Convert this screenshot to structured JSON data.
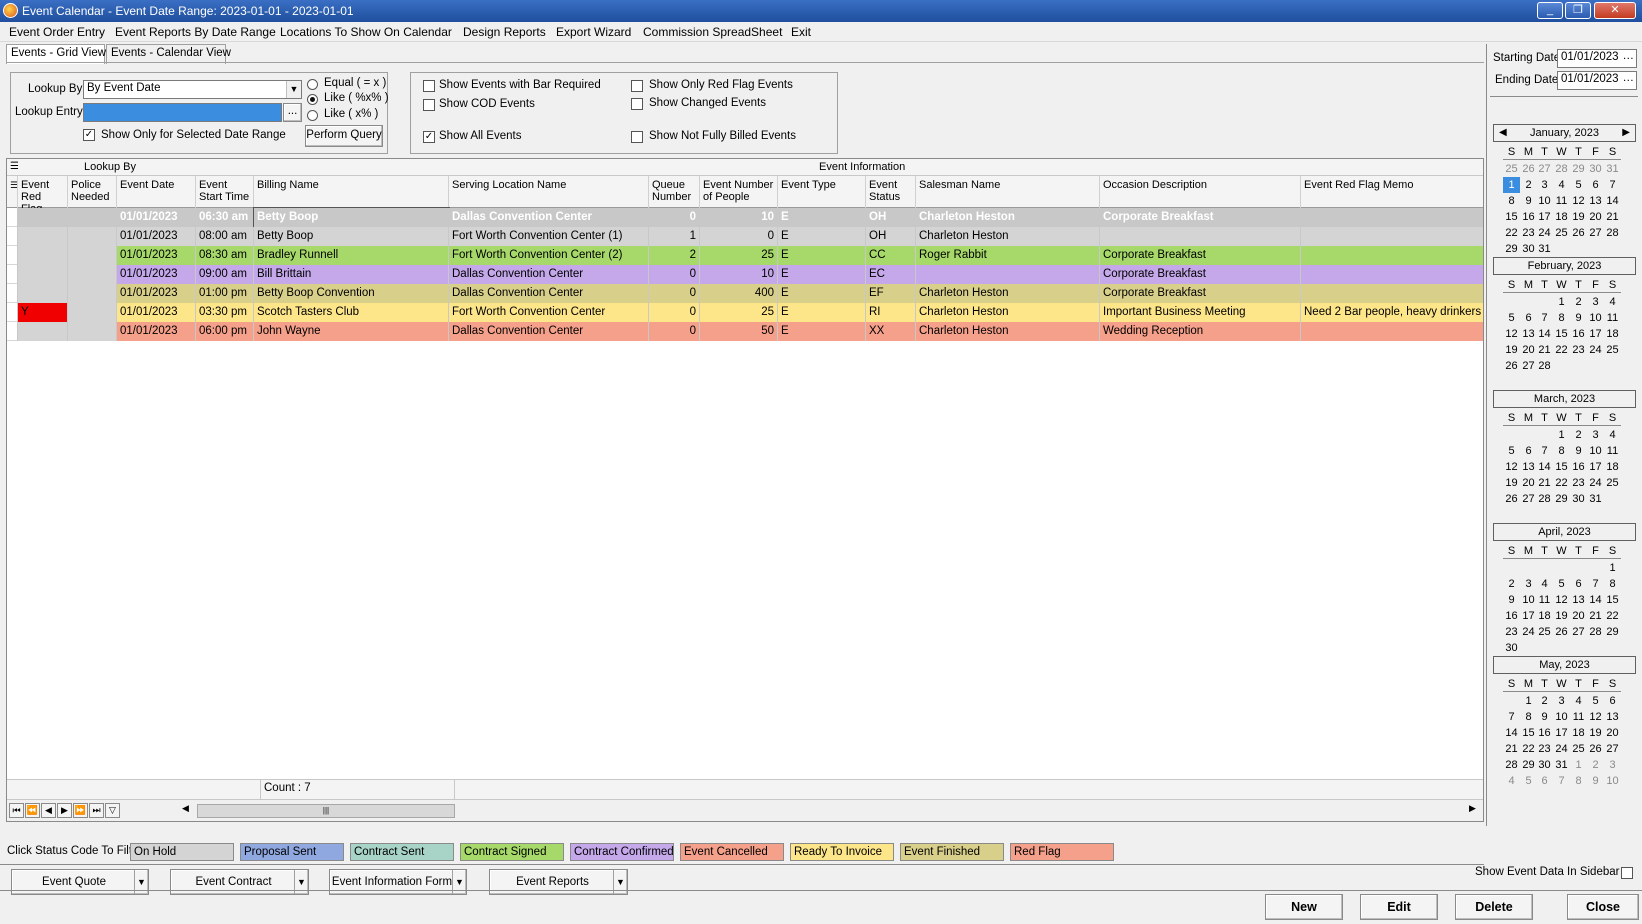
{
  "window": {
    "title": "Event Calendar - Event Date Range: 2023-01-01 - 2023-01-01",
    "minimize": "_",
    "restore": "❐",
    "close": "✕"
  },
  "menu": [
    "Event Order Entry",
    "Event Reports By Date Range",
    "Locations To Show On Calendar",
    "Design Reports",
    "Export Wizard",
    "Commission SpreadSheet",
    "Exit"
  ],
  "tabs": [
    "Events - Grid View",
    "Events - Calendar View"
  ],
  "lookup": {
    "lookup_by_label": "Lookup By",
    "lookup_by_value": "By Event Date",
    "lookup_entry_label": "Lookup Entry",
    "lookup_entry_value": "",
    "ellipsis": "...",
    "radio_equal": "Equal ( = x )",
    "radio_like_both": "Like ( %x% )",
    "radio_like_start": "Like ( x% )",
    "selected_radio": "Like ( %x% )",
    "show_selected_range": "Show Only for Selected Date Range",
    "show_selected_range_checked": true,
    "perform_query": "Perform Query"
  },
  "filters": {
    "bar_required": "Show Events with Bar Required",
    "cod": "Show COD Events",
    "all": "Show All Events",
    "all_checked": true,
    "red_flag": "Show Only Red Flag Events",
    "changed": "Show Changed Events",
    "not_billed": "Show Not Fully Billed Events"
  },
  "grid": {
    "band_lookup": "Lookup By",
    "band_info": "Event Information",
    "columns": {
      "red_flag": "Event Red Flag",
      "police": "Police Needed",
      "date": "Event Date",
      "start": "Event Start Time",
      "billing": "Billing Name",
      "location": "Serving Location Name",
      "queue": "Queue Number",
      "people": "Event Number of People",
      "type": "Event Type",
      "status": "Event Status",
      "salesman": "Salesman Name",
      "occasion": "Occasion Description",
      "memo": "Event Red Flag Memo"
    },
    "rows": [
      {
        "red_flag": "",
        "police": "",
        "date": "01/01/2023",
        "start": "06:30 am",
        "billing": "Betty Boop",
        "location": "Dallas Convention Center",
        "queue": "0",
        "people": "10",
        "type": "E",
        "status": "OH",
        "salesman": "Charleton Heston",
        "occasion": "Corporate Breakfast",
        "memo": "",
        "color": "#c8c8c8",
        "selected": true
      },
      {
        "red_flag": "",
        "police": "",
        "date": "01/01/2023",
        "start": "08:00 am",
        "billing": "Betty Boop",
        "location": "Fort Worth Convention Center (1)",
        "queue": "1",
        "people": "0",
        "type": "E",
        "status": "OH",
        "salesman": "Charleton Heston",
        "occasion": "",
        "memo": "",
        "color": "#d4d4d4",
        "selected": false
      },
      {
        "red_flag": "",
        "police": "",
        "date": "01/01/2023",
        "start": "08:30 am",
        "billing": "Bradley Runnell",
        "location": "Fort Worth Convention Center (2)",
        "queue": "2",
        "people": "25",
        "type": "E",
        "status": "CC",
        "salesman": "Roger Rabbit",
        "occasion": "Corporate Breakfast",
        "memo": "",
        "color": "#a6d96a",
        "selected": false
      },
      {
        "red_flag": "",
        "police": "",
        "date": "01/01/2023",
        "start": "09:00 am",
        "billing": "Bill Brittain",
        "location": "Dallas Convention Center",
        "queue": "0",
        "people": "10",
        "type": "E",
        "status": "EC",
        "salesman": "",
        "occasion": "Corporate Breakfast",
        "memo": "",
        "color": "#c4a8ea",
        "selected": false
      },
      {
        "red_flag": "",
        "police": "",
        "date": "01/01/2023",
        "start": "01:00 pm",
        "billing": "Betty Boop Convention",
        "location": "Dallas Convention Center",
        "queue": "0",
        "people": "400",
        "type": "E",
        "status": "EF",
        "salesman": "Charleton Heston",
        "occasion": "Corporate Breakfast",
        "memo": "",
        "color": "#d8cf8a",
        "selected": false
      },
      {
        "red_flag": "Y",
        "police": "",
        "date": "01/01/2023",
        "start": "03:30 pm",
        "billing": "Scotch Tasters Club",
        "location": "Fort Worth Convention Center",
        "queue": "0",
        "people": "25",
        "type": "E",
        "status": "RI",
        "salesman": "Charleton Heston",
        "occasion": "Important Business Meeting",
        "memo": "Need 2 Bar people, heavy drinkers",
        "color": "#fde68a",
        "selected": false
      },
      {
        "red_flag": "",
        "police": "",
        "date": "01/01/2023",
        "start": "06:00 pm",
        "billing": "John Wayne",
        "location": "Dallas Convention Center",
        "queue": "0",
        "people": "50",
        "type": "E",
        "status": "XX",
        "salesman": "Charleton Heston",
        "occasion": "Wedding Reception",
        "memo": "",
        "color": "#f5a08a",
        "selected": false
      }
    ],
    "count": "Count : 7"
  },
  "status_filter": {
    "label": "Click Status Code To Filter",
    "items": [
      {
        "label": "On Hold",
        "color": "#d4d4d4"
      },
      {
        "label": "Proposal Sent",
        "color": "#8fa8e0"
      },
      {
        "label": "Contract Sent",
        "color": "#a8d4c8"
      },
      {
        "label": "Contract Signed",
        "color": "#a6d96a"
      },
      {
        "label": "Contract Confirmed",
        "color": "#c4a8ea"
      },
      {
        "label": "Event Cancelled",
        "color": "#f5a08a"
      },
      {
        "label": "Ready To Invoice",
        "color": "#fde68a"
      },
      {
        "label": "Event Finished",
        "color": "#d8cf8a"
      },
      {
        "label": "Red Flag",
        "color": "#f5a08a"
      }
    ]
  },
  "actions": {
    "quote": "Event Quote",
    "contract": "Event Contract",
    "info_form": "Event Information Form",
    "reports": "Event Reports",
    "sidebar_label": "Show Event Data In Sidebar",
    "new": "New",
    "edit": "Edit",
    "delete": "Delete",
    "close": "Close"
  },
  "sidebar": {
    "starting_label": "Starting Date",
    "starting_value": "01/01/2023",
    "ending_label": "Ending Date",
    "ending_value": "01/01/2023",
    "dow": [
      "S",
      "M",
      "T",
      "W",
      "T",
      "F",
      "S"
    ],
    "months": [
      {
        "title": "January, 2023",
        "weeks": [
          [
            "25",
            "26",
            "27",
            "28",
            "29",
            "30",
            "31"
          ],
          [
            "1",
            "2",
            "3",
            "4",
            "5",
            "6",
            "7"
          ],
          [
            "8",
            "9",
            "10",
            "11",
            "12",
            "13",
            "14"
          ],
          [
            "15",
            "16",
            "17",
            "18",
            "19",
            "20",
            "21"
          ],
          [
            "22",
            "23",
            "24",
            "25",
            "26",
            "27",
            "28"
          ],
          [
            "29",
            "30",
            "31",
            "",
            "",
            "",
            ""
          ]
        ]
      },
      {
        "title": "February, 2023",
        "weeks": [
          [
            "",
            "",
            "",
            "1",
            "2",
            "3",
            "4"
          ],
          [
            "5",
            "6",
            "7",
            "8",
            "9",
            "10",
            "11"
          ],
          [
            "12",
            "13",
            "14",
            "15",
            "16",
            "17",
            "18"
          ],
          [
            "19",
            "20",
            "21",
            "22",
            "23",
            "24",
            "25"
          ],
          [
            "26",
            "27",
            "28",
            "",
            "",
            "",
            ""
          ]
        ]
      },
      {
        "title": "March, 2023",
        "weeks": [
          [
            "",
            "",
            "",
            "1",
            "2",
            "3",
            "4"
          ],
          [
            "5",
            "6",
            "7",
            "8",
            "9",
            "10",
            "11"
          ],
          [
            "12",
            "13",
            "14",
            "15",
            "16",
            "17",
            "18"
          ],
          [
            "19",
            "20",
            "21",
            "22",
            "23",
            "24",
            "25"
          ],
          [
            "26",
            "27",
            "28",
            "29",
            "30",
            "31",
            ""
          ]
        ]
      },
      {
        "title": "April, 2023",
        "weeks": [
          [
            "",
            "",
            "",
            "",
            "",
            "",
            "1"
          ],
          [
            "2",
            "3",
            "4",
            "5",
            "6",
            "7",
            "8"
          ],
          [
            "9",
            "10",
            "11",
            "12",
            "13",
            "14",
            "15"
          ],
          [
            "16",
            "17",
            "18",
            "19",
            "20",
            "21",
            "22"
          ],
          [
            "23",
            "24",
            "25",
            "26",
            "27",
            "28",
            "29"
          ],
          [
            "30",
            "",
            "",
            "",
            "",
            "",
            ""
          ]
        ]
      },
      {
        "title": "May, 2023",
        "weeks": [
          [
            "",
            "1",
            "2",
            "3",
            "4",
            "5",
            "6"
          ],
          [
            "7",
            "8",
            "9",
            "10",
            "11",
            "12",
            "13"
          ],
          [
            "14",
            "15",
            "16",
            "17",
            "18",
            "19",
            "20"
          ],
          [
            "21",
            "22",
            "23",
            "24",
            "25",
            "26",
            "27"
          ],
          [
            "28",
            "29",
            "30",
            "31",
            "1",
            "2",
            "3"
          ],
          [
            "4",
            "5",
            "6",
            "7",
            "8",
            "9",
            "10"
          ]
        ]
      }
    ]
  }
}
